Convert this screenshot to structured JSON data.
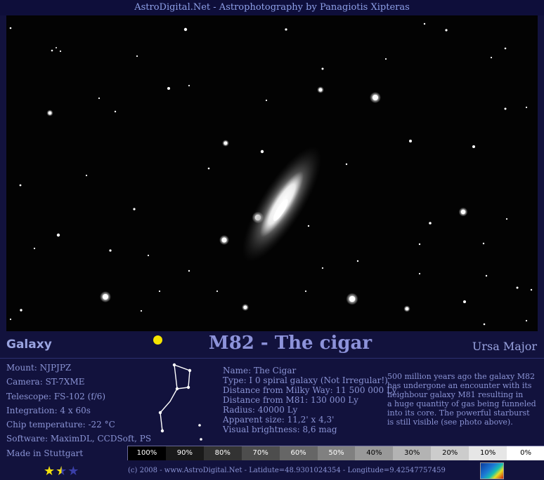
{
  "header": {
    "title": "AstroDigital.Net - Astrophotography by Panagiotis Xipteras"
  },
  "object": {
    "type_label": "Galaxy",
    "title": "M82 - The cigar",
    "constellation": "Ursa Major"
  },
  "details": [
    "Mount: NJPJPZ",
    "Camera: ST-7XME",
    "Telescope: FS-102 (f/6)",
    "Integration: 4 x 60s",
    "Chip temperature: -22 °C",
    "Software: MaximDL, CCDSoft, PS",
    "Made in Stuttgart"
  ],
  "facts": [
    "Name: The Cigar",
    "Type: I 0 spiral galaxy (Not Irregular!)",
    "Distance from Milky Way: 11 500 000 Ly",
    "Distance from M81: 130 000 Ly",
    "Radius: 40000 Ly",
    "Apparent size: 11,2' x 4,3'",
    "Visual brightness: 8,6 mag"
  ],
  "story": [
    "500 million years ago the galaxy M82",
    "has undergone an encounter with its",
    "neighbour galaxy M81 resulting in",
    "a huge quantity of gas being funneled",
    "into its core. The powerful starburst",
    "is still visible (see photo above)."
  ],
  "scale": [
    {
      "label": "100%",
      "bg": "#000000",
      "fg": "#ffffff"
    },
    {
      "label": "90%",
      "bg": "#1a1a1a",
      "fg": "#ffffff"
    },
    {
      "label": "80%",
      "bg": "#333333",
      "fg": "#ffffff"
    },
    {
      "label": "70%",
      "bg": "#4d4d4d",
      "fg": "#ffffff"
    },
    {
      "label": "60%",
      "bg": "#666666",
      "fg": "#ffffff"
    },
    {
      "label": "50%",
      "bg": "#808080",
      "fg": "#ffffff"
    },
    {
      "label": "40%",
      "bg": "#999999",
      "fg": "#000000"
    },
    {
      "label": "30%",
      "bg": "#b3b3b3",
      "fg": "#000000"
    },
    {
      "label": "20%",
      "bg": "#cccccc",
      "fg": "#000000"
    },
    {
      "label": "10%",
      "bg": "#e6e6e6",
      "fg": "#000000"
    },
    {
      "label": "0%",
      "bg": "#ffffff",
      "fg": "#000000"
    }
  ],
  "rating": {
    "value": 1.5,
    "max": 3
  },
  "footer": {
    "text": "(c) 2008 - www.AstroDigital.Net - Latidute=48.9301024354 - Longitude=9.42547757459"
  },
  "colors": {
    "background": "#12123d",
    "text": "#8a93d4",
    "title": "#8d93da",
    "marker": "#f5e400"
  }
}
